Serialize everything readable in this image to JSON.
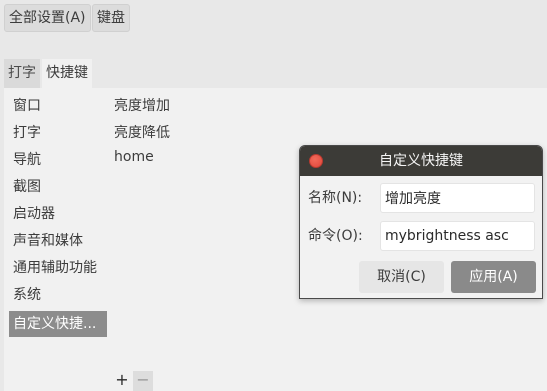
{
  "breadcrumb": {
    "all_settings": "全部设置(A)",
    "keyboard": "键盘"
  },
  "tabs": [
    {
      "label": "打字",
      "active": false
    },
    {
      "label": "快捷键",
      "active": true
    }
  ],
  "categories": [
    {
      "label": "窗口"
    },
    {
      "label": "打字"
    },
    {
      "label": "导航"
    },
    {
      "label": "截图"
    },
    {
      "label": "启动器"
    },
    {
      "label": "声音和媒体"
    },
    {
      "label": "通用辅助功能"
    },
    {
      "label": "系统"
    },
    {
      "label": "自定义快捷...",
      "selected": true
    }
  ],
  "shortcuts": [
    "亮度增加",
    "亮度降低",
    "home"
  ],
  "list_buttons": {
    "add": "+",
    "remove": "−"
  },
  "dialog": {
    "title": "自定义快捷键",
    "name_label": "名称(N):",
    "name_value": "增加亮度",
    "command_label": "命令(O):",
    "command_value": "mybrightness asc",
    "cancel_label": "取消(C)",
    "apply_label": "应用(A)"
  },
  "colors": {
    "selected_row": "#8c8c8c",
    "titlebar": "#3c3b37",
    "close_button": "#e8453a",
    "apply_button": "#8a8a8a"
  }
}
